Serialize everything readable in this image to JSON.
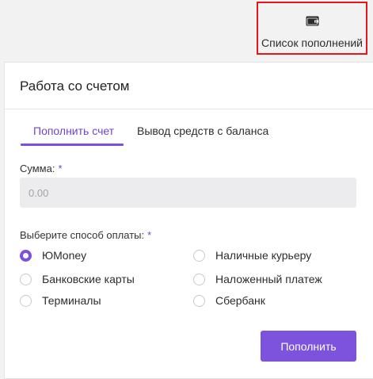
{
  "header": {
    "topup_list_label": "Список пополнений",
    "topup_list_icon": "wallet-icon",
    "highlight_color": "#e8141b"
  },
  "card": {
    "title": "Работа со счетом",
    "tabs": [
      {
        "label": "Пополнить счет",
        "active": true
      },
      {
        "label": "Вывод средств с баланса",
        "active": false
      }
    ]
  },
  "form": {
    "amount_label": "Сумма:",
    "required_mark": "*",
    "amount_placeholder": "0.00",
    "amount_value": "",
    "payment_label": "Выберите способ оплаты:",
    "payment_methods": [
      {
        "label": "ЮMoney",
        "checked": true
      },
      {
        "label": "Наличные курьеру",
        "checked": false
      },
      {
        "label": "Банковские карты",
        "checked": false
      },
      {
        "label": "Наложенный платеж",
        "checked": false
      },
      {
        "label": "Терминалы",
        "checked": false
      },
      {
        "label": "Сбербанк",
        "checked": false
      }
    ],
    "submit_label": "Пополнить"
  },
  "colors": {
    "accent": "#7b4fe0",
    "accent_text": "#6d46c9",
    "page_bg": "#f2f2f3"
  }
}
